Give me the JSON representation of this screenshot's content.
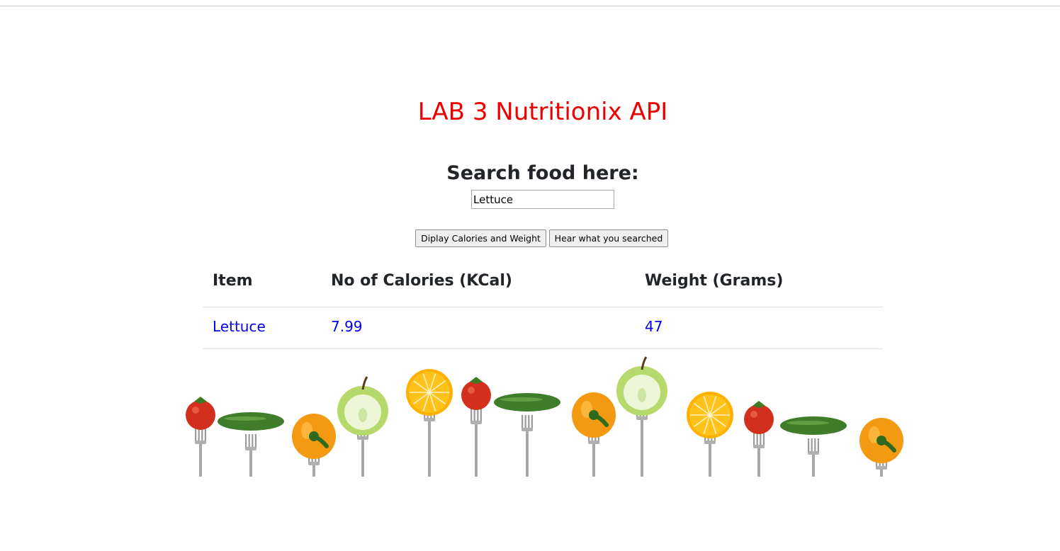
{
  "page": {
    "title": "LAB 3 Nutritionix API",
    "search_label": "Search food here:"
  },
  "search": {
    "value": "Lettuce"
  },
  "buttons": {
    "display_label": "Diplay Calories and Weight",
    "hear_label": "Hear what you searched"
  },
  "table": {
    "headers": [
      "Item",
      "No of Calories (KCal)",
      "Weight (Grams)"
    ],
    "rows": [
      [
        "Lettuce",
        "7.99",
        "47"
      ]
    ]
  },
  "colors": {
    "title": "#ee0000",
    "link_value": "#0000ee",
    "tomato": "#d32f1f",
    "cucumber": "#3f7d2a",
    "pepper": "#f39a12",
    "apple": "#b5d96a",
    "lemon": "#ffc21a"
  },
  "banner": {
    "items": [
      "tomato",
      "cucumber",
      "pepper",
      "apple",
      "lemon",
      "tomato",
      "cucumber",
      "pepper",
      "apple",
      "lemon",
      "tomato",
      "cucumber",
      "pepper"
    ]
  }
}
